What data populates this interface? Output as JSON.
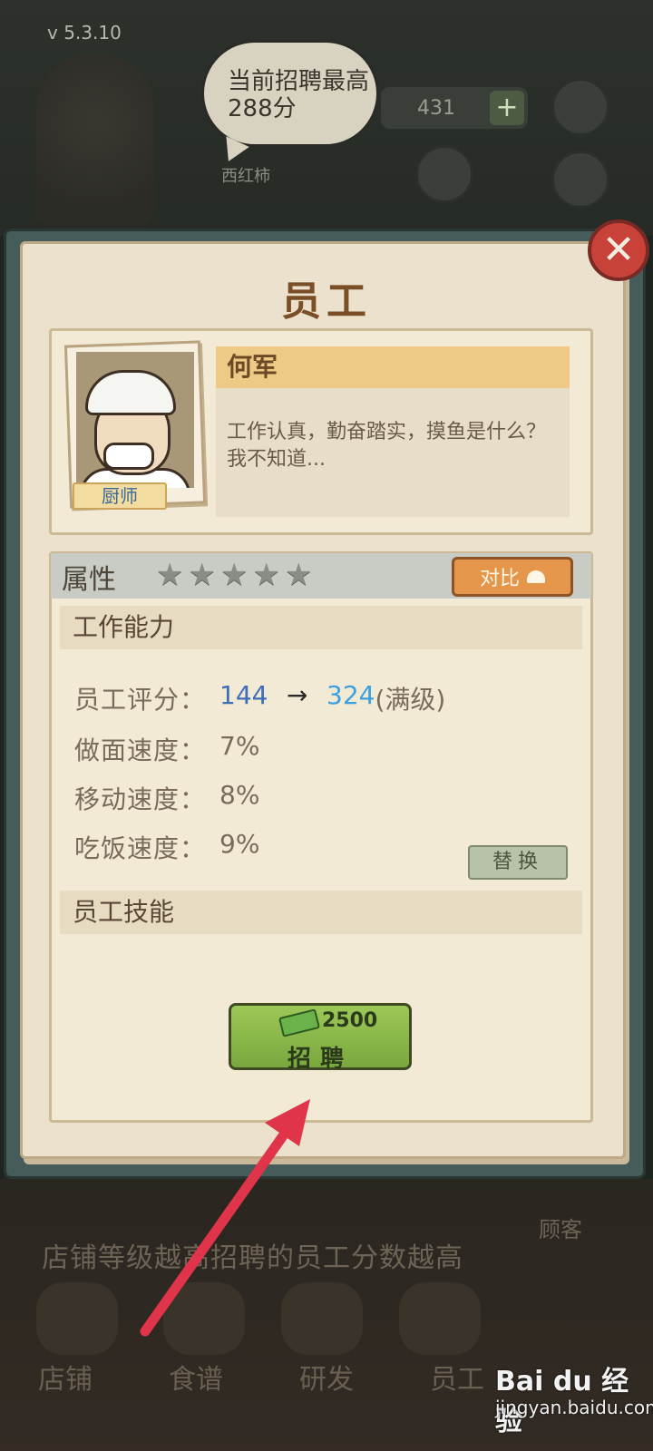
{
  "background": {
    "version": "v  5.3.10",
    "speech_bubble": "当前招聘最高288分",
    "coin_count": "431",
    "coin_plus": "+",
    "tag_text": "西红柿",
    "hint_text": "店铺等级越高招聘的员工分数越高",
    "customer_label": "顾客",
    "tabs": [
      "店铺",
      "食谱",
      "研发",
      "员工"
    ]
  },
  "modal": {
    "title": "员工",
    "close_symbol": "✕",
    "employee": {
      "name": "何军",
      "role": "厨师",
      "description": "工作认真，勤奋踏实，摸鱼是什么？我不知道..."
    },
    "attributes": {
      "title": "属性",
      "stars_filled": 0,
      "stars_total": 5,
      "compare_label": "对比",
      "work_ability_title": "工作能力",
      "score_label": "员工评分：",
      "score_current": "144",
      "score_arrow": "→",
      "score_max": "324",
      "score_max_suffix": "(满级)",
      "stats": [
        {
          "label": "做面速度：",
          "value": "7%"
        },
        {
          "label": "移动速度：",
          "value": "8%"
        },
        {
          "label": "吃饭速度：",
          "value": "9%"
        }
      ],
      "replace_label": "替换",
      "skills_title": "员工技能"
    },
    "hire": {
      "cost": "2500",
      "label": "招聘"
    }
  },
  "watermark": {
    "logo": "Bai du 经验",
    "url": "jingyan.baidu.com"
  },
  "colors": {
    "paper": "#ebe1cc",
    "title_brown": "#7a4e26",
    "score_blue": "#3e6eb8",
    "score_max_blue": "#3aa0e0",
    "hire_green": "#8cba4a",
    "compare_orange": "#e6964a",
    "close_red": "#c8423a",
    "arrow_red": "#e0344a"
  }
}
